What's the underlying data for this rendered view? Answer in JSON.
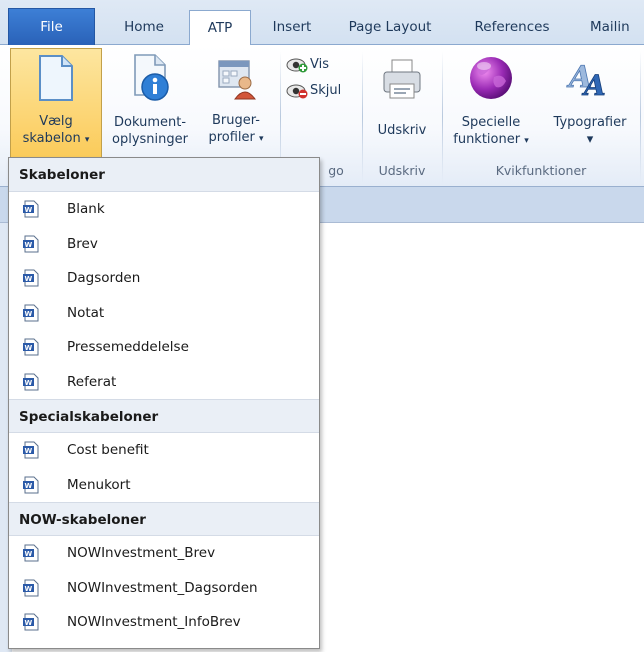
{
  "tabs": [
    {
      "label": "File"
    },
    {
      "label": "Home"
    },
    {
      "label": "ATP"
    },
    {
      "label": "Insert"
    },
    {
      "label": "Page Layout"
    },
    {
      "label": "References"
    },
    {
      "label": "Mailin"
    }
  ],
  "ribbon": {
    "vaelg_line1": "Vælg",
    "vaelg_line2": "skabelon",
    "dokument_line1": "Dokument-",
    "dokument_line2": "oplysninger",
    "bruger_line1": "Bruger-",
    "bruger_line2": "profiler",
    "vis_label": "Vis",
    "skjul_label": "Skjul",
    "logo_group_label": "go",
    "udskriv_button": "Udskriv",
    "udskriv_group_label": "Udskriv",
    "specielle_line1": "Specielle",
    "specielle_line2": "funktioner",
    "typografier_label": "Typografier",
    "kvik_group_label": "Kvikfunktioner"
  },
  "dropdown": {
    "section1_title": "Skabeloner",
    "section1_items": [
      "Blank",
      "Brev",
      "Dagsorden",
      "Notat",
      "Pressemeddelelse",
      "Referat"
    ],
    "section2_title": "Specialskabeloner",
    "section2_items": [
      "Cost benefit",
      "Menukort"
    ],
    "section3_title": "NOW-skabeloner",
    "section3_items": [
      "NOWInvestment_Brev",
      "NOWInvestment_Dagsorden",
      "NOWInvestment_InfoBrev"
    ]
  },
  "colors": {
    "file_tab": "#2a62b8",
    "pressed_button": "#fbcb5a",
    "ribbon_text": "#1e395b"
  }
}
